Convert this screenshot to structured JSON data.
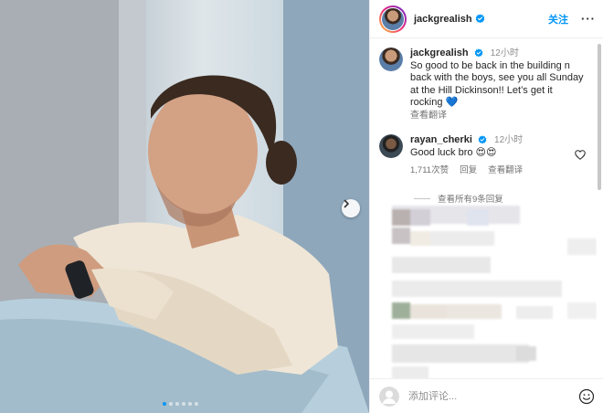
{
  "post": {
    "author": "jackgrealish",
    "follow_label": "关注",
    "more_label": "···",
    "caption": {
      "username": "jackgrealish",
      "time": "12小时",
      "text": "So good to be back in the building n back with the boys, see you all Sunday at the Hill Dickinson!! Let’s get it rocking 💙",
      "translate_label": "查看翻译"
    },
    "comments": [
      {
        "username": "rayan_cherki",
        "time": "12小时",
        "text": "Good luck bro 😍😍",
        "likes": "1,711次赞",
        "reply_label": "回复",
        "translate_label": "查看翻译"
      }
    ],
    "view_replies_label": "查看所有9条回复",
    "comment_placeholder": "添加评论...",
    "carousel": {
      "slide_count": 6,
      "active_index": 0
    }
  },
  "colors": {
    "accent": "#0095f6",
    "verified": "#0095f6",
    "secondary_text": "#737373"
  },
  "icons": {
    "verified": "verified-badge-icon",
    "heart": "heart-icon",
    "next": "chevron-right-icon",
    "emoji": "emoji-icon",
    "avatar": "avatar-icon"
  }
}
